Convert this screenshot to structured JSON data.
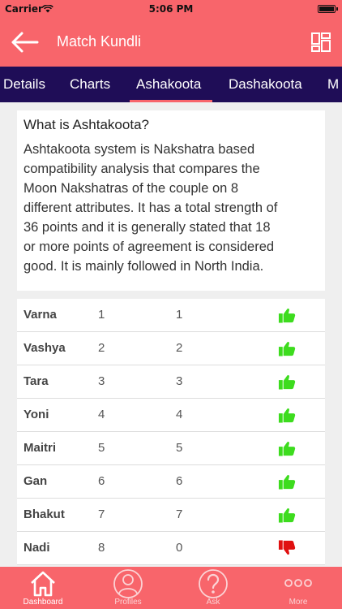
{
  "status_bar": {
    "carrier": "Carrier",
    "time": "5:06 PM"
  },
  "header": {
    "title": "Match Kundli"
  },
  "tabs": [
    {
      "label": "Details",
      "active": false
    },
    {
      "label": "Charts",
      "active": false
    },
    {
      "label": "Ashakoota",
      "active": true
    },
    {
      "label": "Dashakoota",
      "active": false
    },
    {
      "label": "M",
      "active": false
    }
  ],
  "info": {
    "title": "What is Ashtakoota?",
    "line1": "Ashtakoota system is Nakshatra based",
    "line2": "compatibility analysis that compares the",
    "line3": "Moon Nakshatras of the couple on 8",
    "line4": "different attributes. It has a total strength of",
    "line5": "36 points and it is generally stated that 18",
    "line6": "or more points of agreement is considered",
    "line7": "good. It is mainly followed in North India."
  },
  "koota_rows": [
    {
      "name": "Varna",
      "boy": "1",
      "girl": "1",
      "status": "thumbs-up"
    },
    {
      "name": "Vashya",
      "boy": "2",
      "girl": "2",
      "status": "thumbs-up"
    },
    {
      "name": "Tara",
      "boy": "3",
      "girl": "3",
      "status": "thumbs-up"
    },
    {
      "name": "Yoni",
      "boy": "4",
      "girl": "4",
      "status": "thumbs-up"
    },
    {
      "name": "Maitri",
      "boy": "5",
      "girl": "5",
      "status": "thumbs-up"
    },
    {
      "name": "Gan",
      "boy": "6",
      "girl": "6",
      "status": "thumbs-up"
    },
    {
      "name": "Bhakut",
      "boy": "7",
      "girl": "7",
      "status": "thumbs-up"
    },
    {
      "name": "Nadi",
      "boy": "8",
      "girl": "0",
      "status": "thumbs-down"
    }
  ],
  "bottom_nav": [
    {
      "label": "Dashboard",
      "icon": "home-icon",
      "active": true
    },
    {
      "label": "Profiles",
      "icon": "profile-icon",
      "active": false
    },
    {
      "label": "Ask",
      "icon": "question-icon",
      "active": false
    },
    {
      "label": "More",
      "icon": "more-icon",
      "active": false
    }
  ],
  "colors": {
    "primary": "#f8656b",
    "tab_bar": "#1f0d57",
    "thumbs_up": "#3ddc1e",
    "thumbs_down": "#e01010"
  }
}
